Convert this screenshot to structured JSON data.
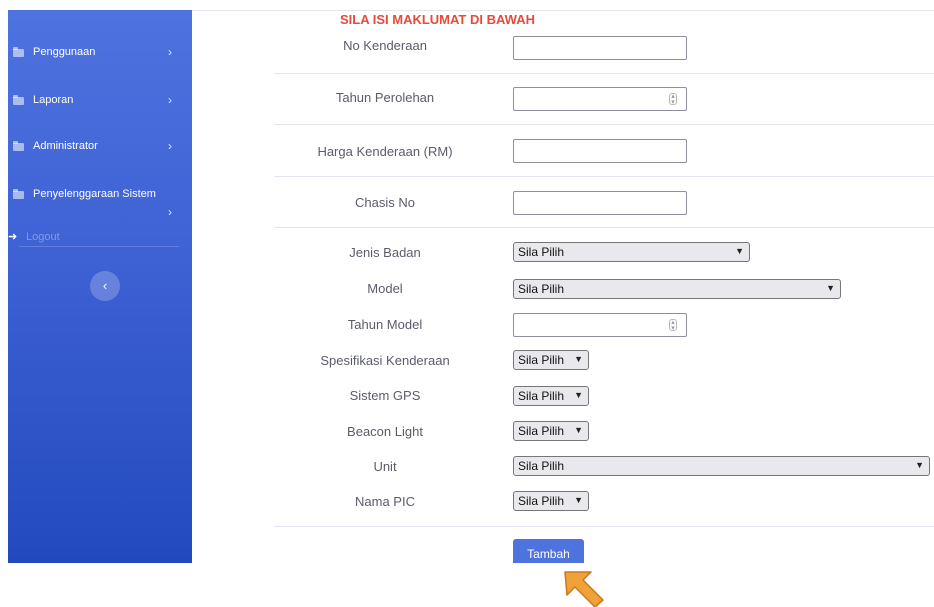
{
  "sidebar": {
    "items": [
      {
        "label": "Penggunaan"
      },
      {
        "label": "Laporan"
      },
      {
        "label": "Administrator"
      },
      {
        "label": "Penyelenggaraan Sistem"
      }
    ],
    "logout_label": "Logout",
    "chevron": "›",
    "toggle": "‹"
  },
  "form": {
    "heading": "SILA ISI MAKLUMAT DI BAWAH",
    "fields": {
      "no_kenderaan": {
        "label": "No Kenderaan",
        "value": ""
      },
      "tahun_perolehan": {
        "label": "Tahun Perolehan",
        "value": ""
      },
      "harga_kenderaan": {
        "label": "Harga Kenderaan (RM)",
        "value": ""
      },
      "chasis_no": {
        "label": "Chasis No",
        "value": ""
      },
      "jenis_badan": {
        "label": "Jenis Badan",
        "selected": "Sila Pilih"
      },
      "model": {
        "label": "Model",
        "selected": "Sila Pilih"
      },
      "tahun_model": {
        "label": "Tahun Model",
        "value": ""
      },
      "spesifikasi": {
        "label": "Spesifikasi Kenderaan",
        "selected": "Sila Pilih"
      },
      "sistem_gps": {
        "label": "Sistem GPS",
        "selected": "Sila Pilih"
      },
      "beacon_light": {
        "label": "Beacon Light",
        "selected": "Sila Pilih"
      },
      "unit": {
        "label": "Unit",
        "selected": "Sila Pilih"
      },
      "nama_pic": {
        "label": "Nama PIC",
        "selected": "Sila Pilih"
      }
    },
    "submit_label": "Tambah"
  },
  "icons": {
    "folder": "folder-icon",
    "chevron": "chevron-right-icon",
    "logout": "sign-out-icon",
    "cursor": "pointer-arrow-icon"
  },
  "colors": {
    "sidebar_top": "#4e73df",
    "sidebar_bottom": "#224abe",
    "heading": "#e74a3b",
    "button": "#4e73df",
    "cursor": "#f0a23a"
  }
}
